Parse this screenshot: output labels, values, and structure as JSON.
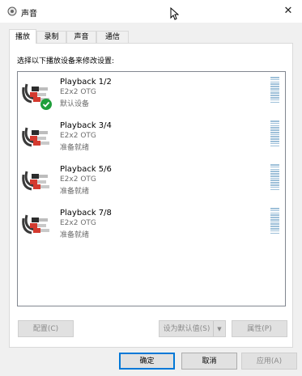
{
  "window": {
    "title": "声音",
    "close_glyph": "✕"
  },
  "tabs": [
    {
      "label": "播放",
      "active": true
    },
    {
      "label": "录制",
      "active": false
    },
    {
      "label": "声音",
      "active": false
    },
    {
      "label": "通信",
      "active": false
    }
  ],
  "instruction": "选择以下播放设备来修改设置:",
  "devices": [
    {
      "name": "Playback 1/2",
      "subtitle": "E2x2 OTG",
      "status": "默认设备",
      "is_default": true
    },
    {
      "name": "Playback 3/4",
      "subtitle": "E2x2 OTG",
      "status": "准备就绪",
      "is_default": false
    },
    {
      "name": "Playback 5/6",
      "subtitle": "E2x2 OTG",
      "status": "准备就绪",
      "is_default": false
    },
    {
      "name": "Playback 7/8",
      "subtitle": "E2x2 OTG",
      "status": "准备就绪",
      "is_default": false
    }
  ],
  "panel_buttons": {
    "configure": "配置(C)",
    "set_default": "设为默认值(S)",
    "set_default_arrow": "▼",
    "properties": "属性(P)"
  },
  "dialog_buttons": {
    "ok": "确定",
    "cancel": "取消",
    "apply": "应用(A)"
  },
  "icons": {
    "title": "speaker-icon",
    "device": "rca-cable-icon",
    "default_badge": "green-check-icon",
    "level_meter": "level-meter-icon"
  },
  "colors": {
    "accent": "#0078d7",
    "check_green": "#1e9e3a",
    "meter": "#9ec0d9"
  }
}
